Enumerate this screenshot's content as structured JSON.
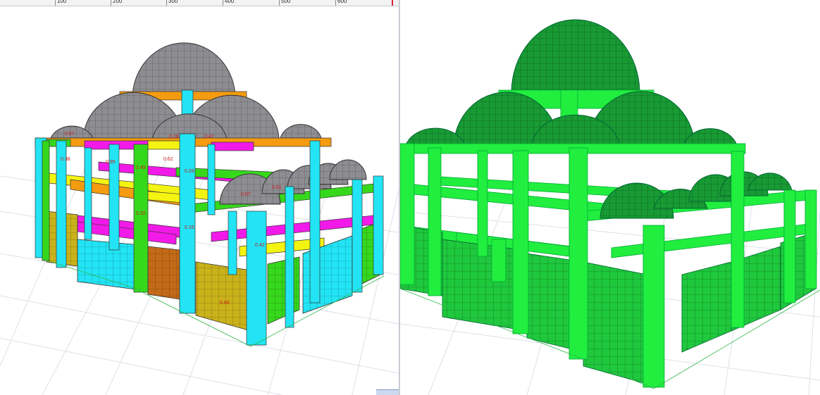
{
  "ruler": {
    "labels": [
      "100",
      "200",
      "300",
      "400",
      "500",
      "600"
    ]
  },
  "left_view": {
    "ratio_labels": [
      "0.29",
      "0.49",
      "0.32",
      "0.15",
      "0.42",
      "0.67",
      "0.61",
      "0.60",
      "0.57",
      "0.76",
      "0.47",
      "0.38",
      "0.62",
      "0.95"
    ]
  },
  "colors": {
    "cyan": "#22e4f4",
    "magenta": "#f21ae8",
    "orange": "#f49b10",
    "yellow": "#f4f412",
    "green": "#36d81c",
    "brown": "#c26a18",
    "olive": "#c9b21a",
    "dome_gray": "#8d8d92",
    "green_model": "#21ee3f",
    "green_model_dark": "#189a34",
    "grid": "#d4d9e2"
  }
}
